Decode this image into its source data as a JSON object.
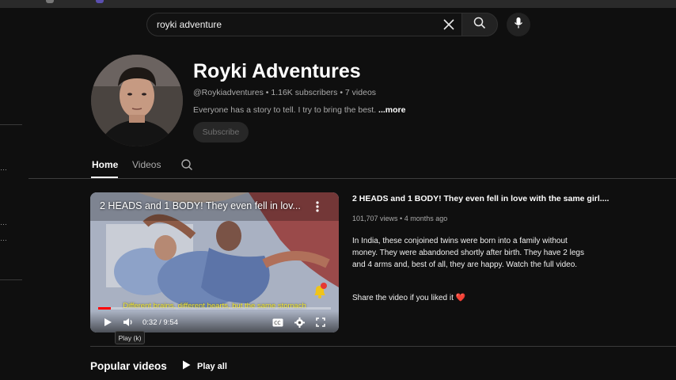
{
  "search": {
    "query": "royki adventure"
  },
  "icons": {
    "clear": "close-icon",
    "search": "search-icon",
    "mic": "microphone-icon",
    "kebab": "more-vert-icon",
    "bell": "bell-icon",
    "play": "play-icon",
    "volume": "volume-icon",
    "captions": "captions-icon",
    "settings": "gear-icon",
    "fullscreen": "fullscreen-icon"
  },
  "channel": {
    "name": "Royki Adventures",
    "handle_line": "@Roykiadventures • 1.16K subscribers • 7 videos",
    "description": "Everyone has a story to tell. I try to bring the best.",
    "more_label": "...more",
    "subscribe_label": "Subscribe"
  },
  "tabs": {
    "home": "Home",
    "videos": "Videos"
  },
  "featured": {
    "player_title": "2 HEADS and 1 BODY! They even fell in lov...",
    "subtitle_text": "Different brains, different hearts, but the same stomach",
    "time": "0:32 / 9:54",
    "progress_fraction": 0.055,
    "bell_badge": "1",
    "tooltip": "Play (k)",
    "title": "2 HEADS and 1 BODY! They even fell in love with the same girl....",
    "meta": "101,707 views • 4 months ago",
    "description": "In India, these conjoined twins were born into a family without money. They were abandoned shortly after birth. They have 2 legs and 4 arms and, best of all, they are happy. Watch the full video.",
    "share_line": "Share the video if you liked it",
    "heart": "❤️"
  },
  "popular": {
    "title": "Popular videos",
    "play_all": "Play all"
  },
  "colors": {
    "background": "#0f0f0f",
    "progress": "#ff0000",
    "subtitle": "#f5ea2a",
    "heart": "#e53935"
  }
}
